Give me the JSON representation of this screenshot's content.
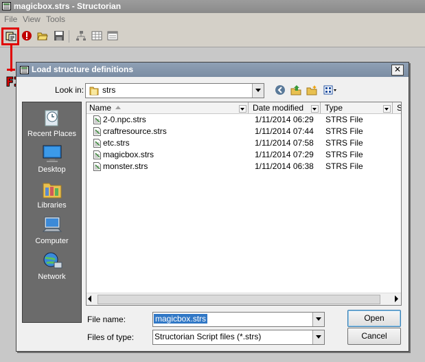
{
  "window": {
    "title": "magicbox.strs - Structorian"
  },
  "menu": {
    "items": [
      "File",
      "View",
      "Tools"
    ]
  },
  "annotation": {
    "label": "FIRST"
  },
  "dialog": {
    "title": "Load structure definitions",
    "close": "✕",
    "look_in_label": "Look in:",
    "look_in_value": "strs",
    "places": [
      "Recent Places",
      "Desktop",
      "Libraries",
      "Computer",
      "Network"
    ],
    "columns": [
      "Name",
      "Date modified",
      "Type",
      "S"
    ],
    "files": [
      {
        "name": "2-0.npc.strs",
        "date": "1/11/2014 06:29",
        "type": "STRS File"
      },
      {
        "name": "craftresource.strs",
        "date": "1/11/2014 07:44",
        "type": "STRS File"
      },
      {
        "name": "etc.strs",
        "date": "1/11/2014 07:58",
        "type": "STRS File"
      },
      {
        "name": "magicbox.strs",
        "date": "1/11/2014 07:29",
        "type": "STRS File"
      },
      {
        "name": "monster.strs",
        "date": "1/11/2014 06:38",
        "type": "STRS File"
      }
    ],
    "file_name_label": "File name:",
    "file_name_value": "magicbox.strs",
    "file_type_label": "Files of type:",
    "file_type_value": "Structorian Script files (*.strs)",
    "open_label": "Open",
    "cancel_label": "Cancel"
  }
}
